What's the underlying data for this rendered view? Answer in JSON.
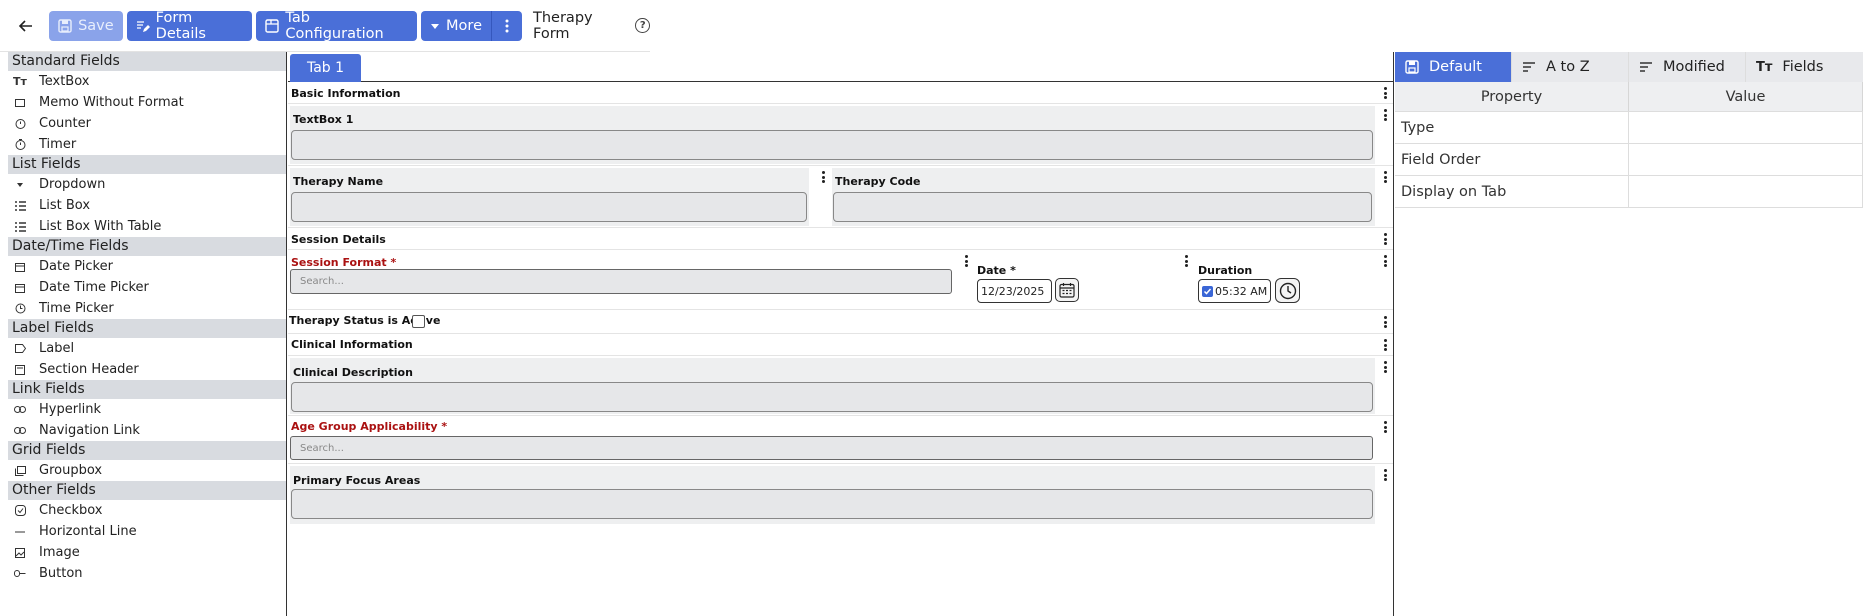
{
  "toolbar": {
    "save_label": "Save",
    "form_details_label": "Form Details",
    "tab_config_label": "Tab Configuration",
    "more_label": "More",
    "form_title": "Therapy Form",
    "help_glyph": "?"
  },
  "palette": {
    "categories": [
      {
        "title": "Standard Fields",
        "items": [
          "TextBox",
          "Memo Without Format",
          "Counter",
          "Timer"
        ]
      },
      {
        "title": "List Fields",
        "items": [
          "Dropdown",
          "List Box",
          "List Box With Table"
        ]
      },
      {
        "title": "Date/Time Fields",
        "items": [
          "Date Picker",
          "Date Time Picker",
          "Time Picker"
        ]
      },
      {
        "title": "Label Fields",
        "items": [
          "Label",
          "Section Header"
        ]
      },
      {
        "title": "Link Fields",
        "items": [
          "Hyperlink",
          "Navigation Link"
        ]
      },
      {
        "title": "Grid Fields",
        "items": [
          "Groupbox"
        ]
      },
      {
        "title": "Other Fields",
        "items": [
          "Checkbox",
          "Horizontal Line",
          "Image",
          "Button"
        ]
      }
    ]
  },
  "canvas": {
    "tab_label": "Tab 1",
    "sections": {
      "basic": "Basic Information",
      "session": "Session Details",
      "clinical": "Clinical Information"
    },
    "fields": {
      "textbox1": "TextBox 1",
      "therapy_name": "Therapy Name",
      "therapy_code": "Therapy Code",
      "session_format": "Session Format *",
      "session_format_placeholder": "Search...",
      "date": "Date *",
      "date_value": "12/23/2025",
      "duration": "Duration",
      "duration_value": "05:32 AM",
      "status_active": "Therapy Status is Active",
      "clinical_description": "Clinical Description",
      "age_group": "Age Group Applicability *",
      "age_group_placeholder": "Search...",
      "primary_focus": "Primary Focus Areas"
    }
  },
  "props": {
    "tabs": [
      "Default",
      "A to Z",
      "Modified",
      "Fields"
    ],
    "columns": [
      "Property",
      "Value"
    ],
    "rows": [
      {
        "property": "Type",
        "value": ""
      },
      {
        "property": "Field Order",
        "value": ""
      },
      {
        "property": "Display on Tab",
        "value": ""
      }
    ]
  },
  "colors": {
    "accent": "#4a6fd8",
    "required": "#aa1111",
    "category_bg": "#d8dbe0"
  }
}
